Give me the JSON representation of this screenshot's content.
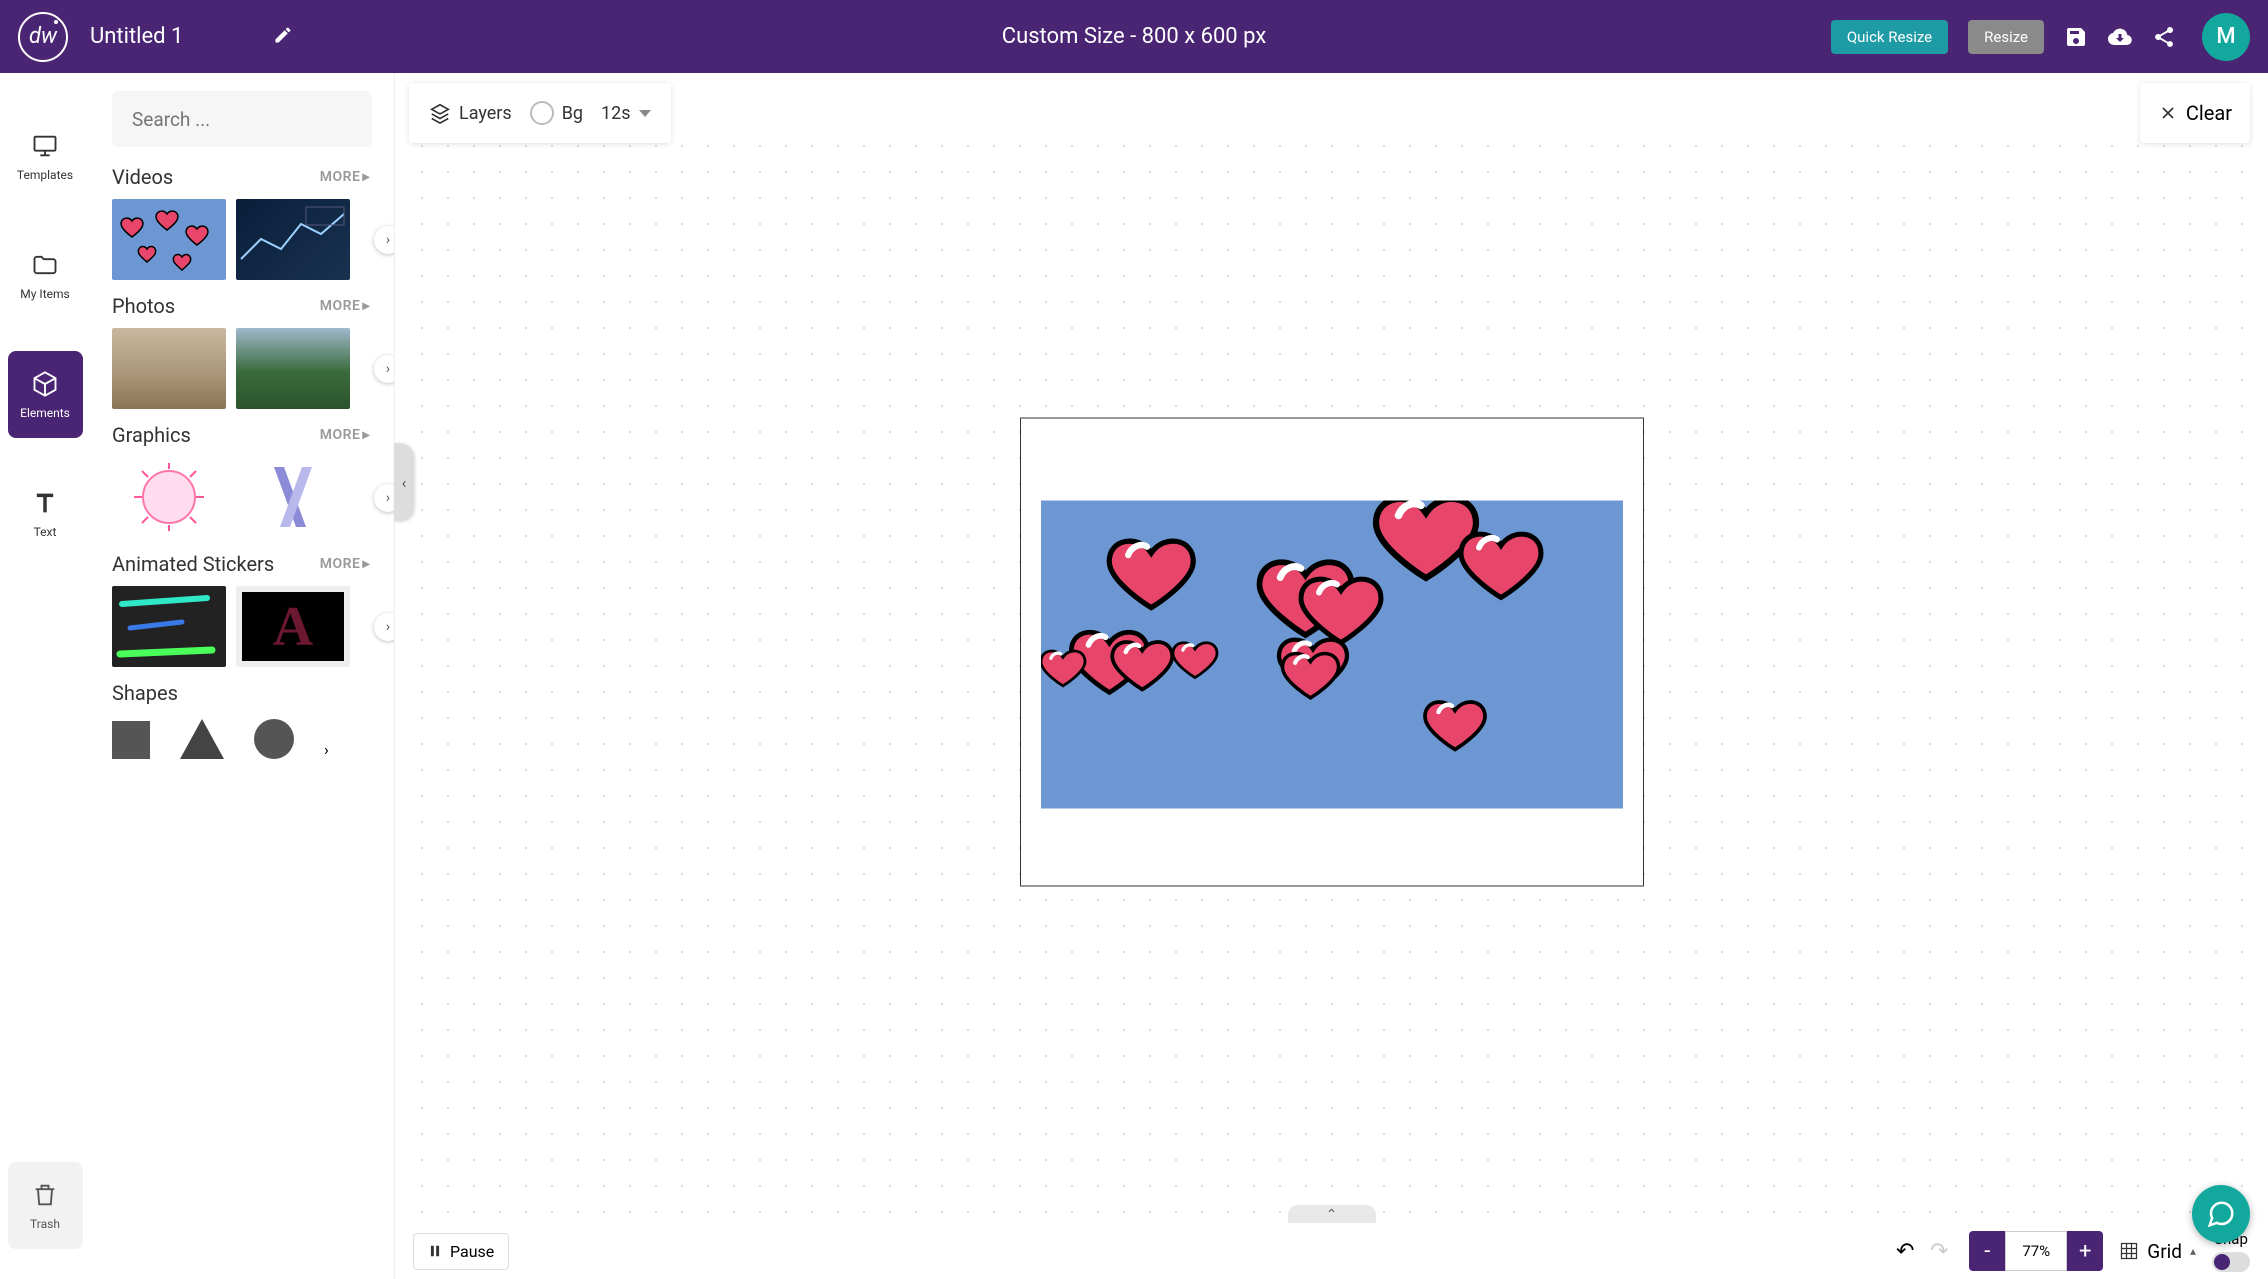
{
  "header": {
    "logo_text": "dw",
    "title": "Untitled 1",
    "doc_size": "Custom Size - 800 x 600 px",
    "quick_resize": "Quick Resize",
    "resize": "Resize",
    "avatar_initial": "M"
  },
  "rail": {
    "templates": "Templates",
    "my_items": "My Items",
    "elements": "Elements",
    "text": "Text",
    "trash": "Trash"
  },
  "panel": {
    "search_placeholder": "Search ...",
    "more": "MORE",
    "sections": {
      "videos": "Videos",
      "photos": "Photos",
      "graphics": "Graphics",
      "stickers": "Animated Stickers",
      "shapes": "Shapes"
    }
  },
  "toolbar": {
    "layers": "Layers",
    "bg": "Bg",
    "duration": "12s",
    "clear": "Clear"
  },
  "bottom": {
    "pause": "Pause",
    "zoom": "77%",
    "grid": "Grid",
    "snap": "Snap"
  },
  "colors": {
    "brand": "#4A2574",
    "teal": "#13A89E"
  }
}
